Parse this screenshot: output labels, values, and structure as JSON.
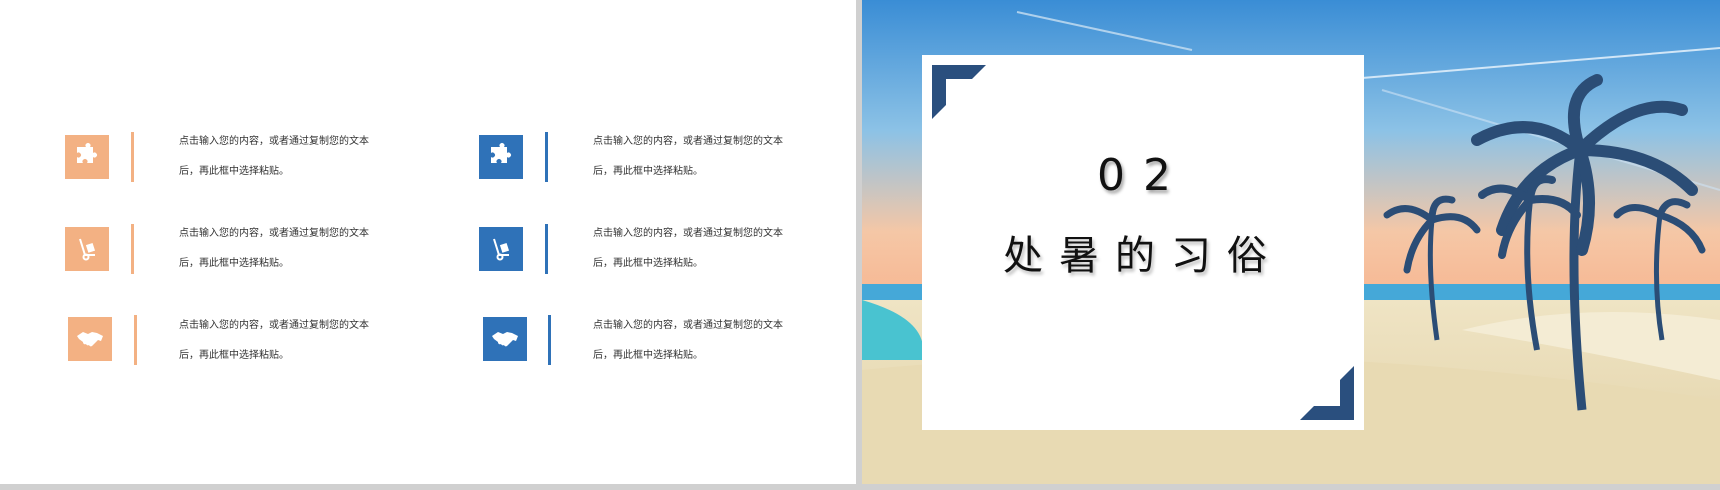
{
  "colors": {
    "accent_orange": "#f3b183",
    "accent_blue": "#2f72b8",
    "corner_navy": "#2a4f7e"
  },
  "items": [
    {
      "icon": "puzzle-icon",
      "line1": "点击输入您的内容，或者通过复制您的文本",
      "line2": "后，再此框中选择粘贴。"
    },
    {
      "icon": "hand-truck-icon",
      "line1": "点击输入您的内容，或者通过复制您的文本",
      "line2": "后，再此框中选择粘贴。"
    },
    {
      "icon": "handshake-icon",
      "line1": "点击输入您的内容，或者通过复制您的文本",
      "line2": "后，再此框中选择粘贴。"
    },
    {
      "icon": "puzzle-icon",
      "line1": "点击输入您的内容，或者通过复制您的文本",
      "line2": "后，再此框中选择粘贴。"
    },
    {
      "icon": "hand-truck-icon",
      "line1": "点击输入您的内容，或者通过复制您的文本",
      "line2": "后，再此框中选择粘贴。"
    },
    {
      "icon": "handshake-icon",
      "line1": "点击输入您的内容，或者通过复制您的文本",
      "line2": "后，再此框中选择粘贴。"
    }
  ],
  "section": {
    "number": "02",
    "title": "处暑的习俗"
  }
}
